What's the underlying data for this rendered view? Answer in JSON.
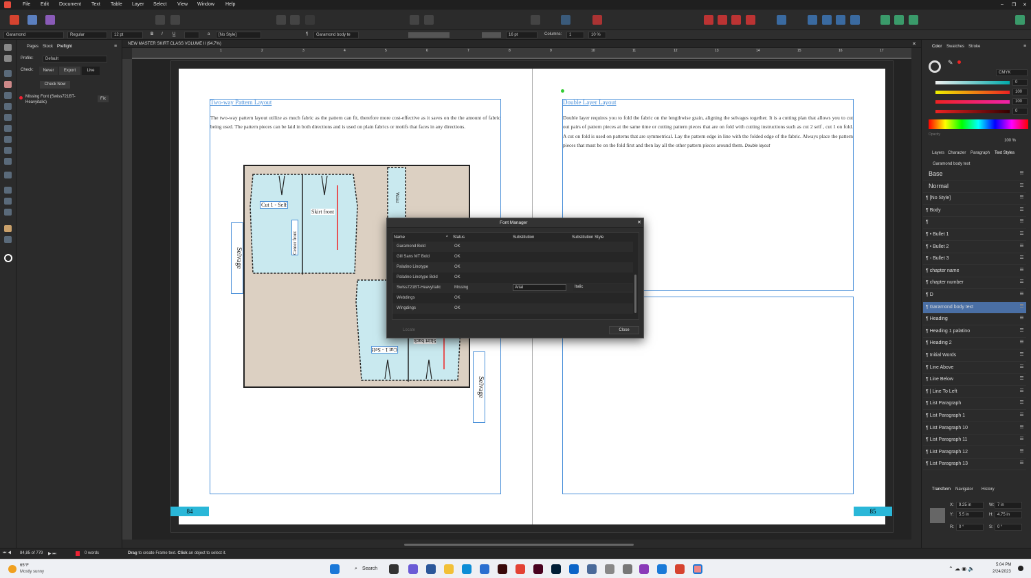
{
  "menu": [
    "File",
    "Edit",
    "Document",
    "Text",
    "Table",
    "Layer",
    "Select",
    "View",
    "Window",
    "Help"
  ],
  "context": {
    "font": "Garamond",
    "weight": "Regular",
    "size": "12 pt",
    "char_style": "[No Style]",
    "para_style": "Garamond body te",
    "leading": "16 pt",
    "columns_label": "Columns:",
    "columns": "1",
    "gutter": "10 %"
  },
  "left_panel": {
    "tabs": [
      "Pages",
      "Stock",
      "Preflight"
    ],
    "profile_label": "Profile:",
    "profile": "Default",
    "check_label": "Check:",
    "check_options": [
      "Never",
      "Export",
      "Live"
    ],
    "check_now": "Check Now",
    "issue": "Missing Font (Swiss721BT-Heavyitalic)",
    "fix": "Fix"
  },
  "doc_tab": "NEW MASTER SKIRT CLASS VOLUME II (94.7%)",
  "ruler_ticks": [
    "1",
    "2",
    "3",
    "4",
    "5",
    "6",
    "7",
    "8",
    "9",
    "10",
    "11",
    "12",
    "13",
    "14",
    "15",
    "16",
    "17"
  ],
  "left_page": {
    "heading": "Two-way Pattern Layout",
    "body": "The two-way pattern layout utilize as much fabric as the pattern can fit, therefore more cost-effective as it saves on the the amount of fabric being used. The pattern pieces can be laid in both directions and is used on plain fabrics or motifs that faces in any directions.",
    "page_number": "84",
    "labels": {
      "cut1": "Cut 1 - Self",
      "skirt_front": "Skirt front",
      "center_front": "Center front",
      "waist": "Waist",
      "skirt_back": "Skirt back",
      "cut1_self": "Cut 1 - Self",
      "selvage_left": "Selvage",
      "selvage_right": "Selvage"
    }
  },
  "right_page": {
    "heading": "Double Layer Layout",
    "body": "Double layer requires you to fold the fabric on the lengthwise grain, aligning the selvages together. It is a cutting plan that allows you to cut out pairs of pattern pieces at the same time or cutting pattern pieces that are on fold with cutting instructions such as cut 2 self , cut 1 on fold. A cut on fold is used on patterns that are symmetrical. Lay the pattern edge in line with the folded edge of the fabric. Always place the pattern pieces that must be on the fold first and then lay all the other pattern pieces around them.",
    "trailing": "Double layout",
    "page_number": "85"
  },
  "font_manager": {
    "title": "Font Manager",
    "columns": [
      "Name",
      "Status",
      "Substitution",
      "Substitution Style"
    ],
    "rows": [
      {
        "name": "Garamond Bold",
        "status": "OK"
      },
      {
        "name": "Gill Sans MT Bold",
        "status": "OK"
      },
      {
        "name": "Palatino Linotype",
        "status": "OK"
      },
      {
        "name": "Palatino Linotype Bold",
        "status": "OK"
      },
      {
        "name": "Swiss721BT-HeavyItalic",
        "status": "Missing",
        "substitution": "Arial",
        "style": "Italic"
      },
      {
        "name": "Webdings",
        "status": "OK"
      },
      {
        "name": "Wingdings",
        "status": "OK"
      }
    ],
    "locate": "Locate",
    "close": "Close"
  },
  "color_panel": {
    "tabs": [
      "Color",
      "Swatches",
      "Stroke"
    ],
    "model": "CMYK",
    "c": "0",
    "m": "100",
    "y": "100",
    "k": "0",
    "opacity_label": "Opacity",
    "opacity": "100 %"
  },
  "text_styles": {
    "tabs": [
      "Layers",
      "Character",
      "Paragraph",
      "Text Styles"
    ],
    "current": "Garamond body text",
    "items": [
      "Base",
      "Normal",
      "¶ [No Style]",
      "¶ Body",
      "¶",
      "¶ • Bullet 1",
      "¶ • Bullet 2",
      "¶ ◦ Bullet 3",
      "¶ chapter name",
      "¶ chapter number",
      "¶ D",
      "¶ Garamond body text",
      "¶ Heading",
      "¶ Heading 1 palatino",
      "¶ Heading 2",
      "¶ Initial Words",
      "¶ Line Above",
      "¶ Line Below",
      "¶ | Line To Left",
      "¶ List Paragraph",
      "¶ List Paragraph 1",
      "¶ List Paragraph 10",
      "¶ List Paragraph 11",
      "¶ List Paragraph 12",
      "¶ List Paragraph 13"
    ],
    "selected_index": 11
  },
  "transform": {
    "tabs": [
      "Transform",
      "Navigator",
      "History"
    ],
    "x": "9.25 in",
    "y": "5.5 in",
    "w": "7 in",
    "h": "4.75 in",
    "r": "0 °",
    "s": "0 °"
  },
  "status": {
    "pages": "84,85 of 779",
    "words": "0 words",
    "hint_pre": "Drag",
    "hint_mid": " to create Frame text. ",
    "hint_click": "Click",
    "hint_post": " an object to select it."
  },
  "taskbar": {
    "temp": "65°F",
    "weather": "Mostly sunny",
    "search": "Search",
    "time": "5:04 PM",
    "date": "2/24/2023"
  },
  "colors": {
    "accent": "#4a90d9",
    "page_tab": "#2ab7d8",
    "pattern": "#c9e9ef",
    "fabric": "#dcd0c2"
  }
}
